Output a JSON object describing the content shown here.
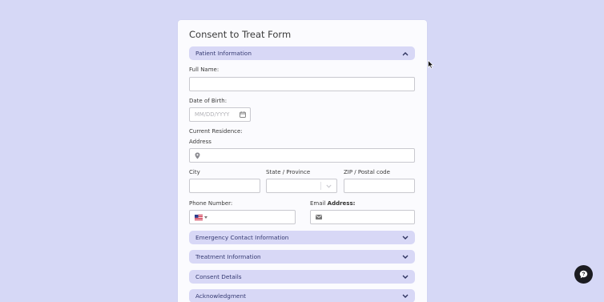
{
  "form": {
    "title": "Consent to Treat Form",
    "sections": {
      "patient": "Patient Information",
      "emergency": "Emergency Contact Information",
      "treatment": "Treatment Information",
      "consent": "Consent Details",
      "acknowledgment": "Acknowledgment"
    },
    "fields": {
      "full_name_label": "Full Name:",
      "full_name_value": "",
      "dob_label": "Date of Birth:",
      "dob_placeholder": "MM/DD/YYYY",
      "residence_label": "Current Residence:",
      "address_label": "Address",
      "address_value": "",
      "city_label": "City",
      "state_label": "State / Province",
      "zip_label": "ZIP / Postal code",
      "phone_label": "Phone Number:",
      "email_label_prefix": "Email ",
      "email_label_bold": "Address:"
    }
  },
  "icons": {
    "patient_toggle": "chevron-up-icon",
    "collapsed_toggle": "chevron-down-icon",
    "calendar": "calendar-icon",
    "location": "map-pin-icon",
    "flag": "us-flag-icon",
    "email": "envelope-icon",
    "chat": "chat-bubble-icon"
  },
  "colors": {
    "background": "#d6d8f6",
    "section_bar": "#d8d8f6",
    "section_text": "#353a72",
    "chat_button": "#1c1c21"
  }
}
